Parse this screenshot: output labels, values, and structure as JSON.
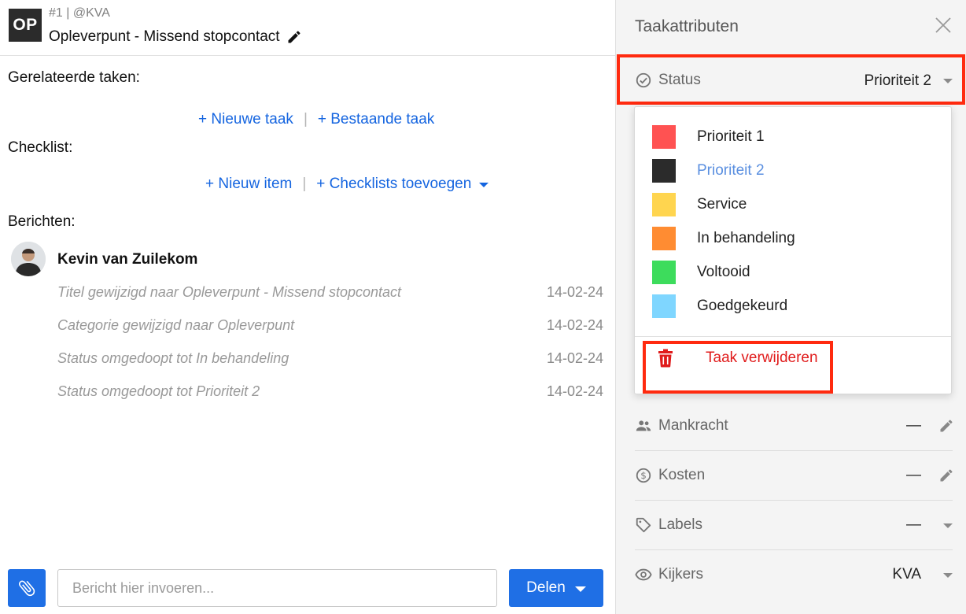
{
  "task": {
    "badge": "OP",
    "meta": "#1 | @KVA",
    "title": "Opleverpunt - Missend stopcontact"
  },
  "related": {
    "label": "Gerelateerde taken:",
    "new_task": "+ Nieuwe taak",
    "separator": "|",
    "existing_task": "+ Bestaande taak"
  },
  "checklist": {
    "label": "Checklist:",
    "new_item": "+ Nieuw item",
    "separator": "|",
    "add_checklists": "+ Checklists toevoegen"
  },
  "messages": {
    "label": "Berichten:",
    "author": "Kevin van Zuilekom",
    "entries": [
      {
        "text": "Titel gewijzigd naar Opleverpunt - Missend stopcontact",
        "date": "14-02-24"
      },
      {
        "text": "Categorie gewijzigd naar Opleverpunt",
        "date": "14-02-24"
      },
      {
        "text": "Status omgedoopt tot In behandeling",
        "date": "14-02-24"
      },
      {
        "text": "Status omgedoopt tot Prioriteit 2",
        "date": "14-02-24"
      }
    ]
  },
  "composer": {
    "placeholder": "Bericht hier invoeren...",
    "share_label": "Delen"
  },
  "panel": {
    "title": "Taakattributen",
    "status": {
      "label": "Status",
      "value": "Prioriteit 2"
    },
    "status_options": [
      {
        "label": "Prioriteit 1",
        "color": "#ff5252"
      },
      {
        "label": "Prioriteit 2",
        "color": "#2b2b2b",
        "selected": true
      },
      {
        "label": "Service",
        "color": "#ffd54f"
      },
      {
        "label": "In behandeling",
        "color": "#ff8c32"
      },
      {
        "label": "Voltooid",
        "color": "#3ddc5c"
      },
      {
        "label": "Goedgekeurd",
        "color": "#7fd6ff"
      }
    ],
    "delete_label": "Taak verwijderen",
    "attributes": [
      {
        "label": "Mankracht",
        "value": "—",
        "icon": "people-icon",
        "action": "edit"
      },
      {
        "label": "Kosten",
        "value": "—",
        "icon": "dollar-icon",
        "action": "edit"
      },
      {
        "label": "Labels",
        "value": "—",
        "icon": "tag-icon",
        "action": "dropdown"
      },
      {
        "label": "Kijkers",
        "value": "KVA",
        "icon": "eye-icon",
        "action": "dropdown"
      }
    ]
  },
  "colors": {
    "accent": "#1f6fe5",
    "link": "#1565e0",
    "highlight": "#ff2a0f",
    "danger": "#e01b1b"
  }
}
